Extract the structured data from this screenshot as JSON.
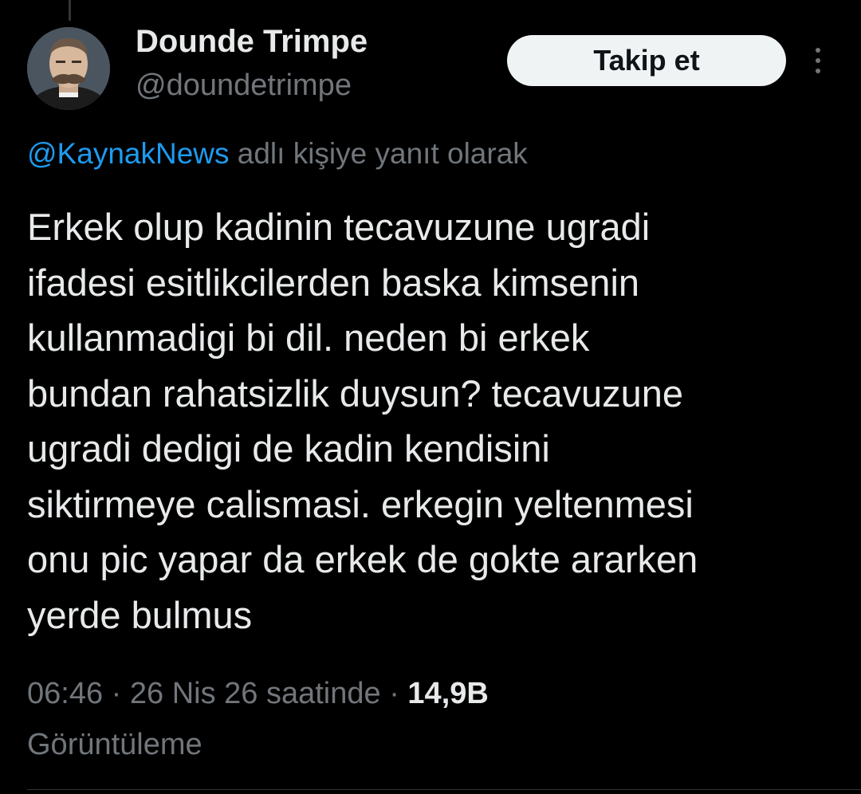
{
  "author": {
    "display_name": "Dounde Trimpe",
    "handle": "@doundetrimpe",
    "avatar": "bearded-man-portrait"
  },
  "follow_button": {
    "label": "Takip et"
  },
  "more_button": {
    "icon": "more-vertical-icon"
  },
  "reply_context": {
    "mention": "@KaynakNews",
    "suffix": "adlı kişiye yanıt olarak"
  },
  "tweet": {
    "lines": [
      "Erkek olup kadinin tecavuzune ugradi",
      "ifadesi esitlikcilerden baska kimsenin",
      "kullanmadigi bi dil. neden bi erkek",
      "bundan rahatsizlik duysun? tecavuzune",
      "ugradi dedigi de kadin kendisini",
      "siktirmeye calismasi. erkegin yeltenmesi",
      "onu pic yapar da erkek de gokte ararken",
      "yerde bulmus"
    ]
  },
  "meta": {
    "time": "06:46",
    "separator": "·",
    "date": "26 Nis 26 saatinde",
    "views_count": "14,9B",
    "views_label": "Görüntüleme"
  },
  "colors": {
    "background": "#000000",
    "text_primary": "#e7e9ea",
    "text_secondary": "#71767b",
    "link": "#1d9bf0",
    "button_bg": "#eff3f4",
    "button_text": "#0f1419"
  }
}
